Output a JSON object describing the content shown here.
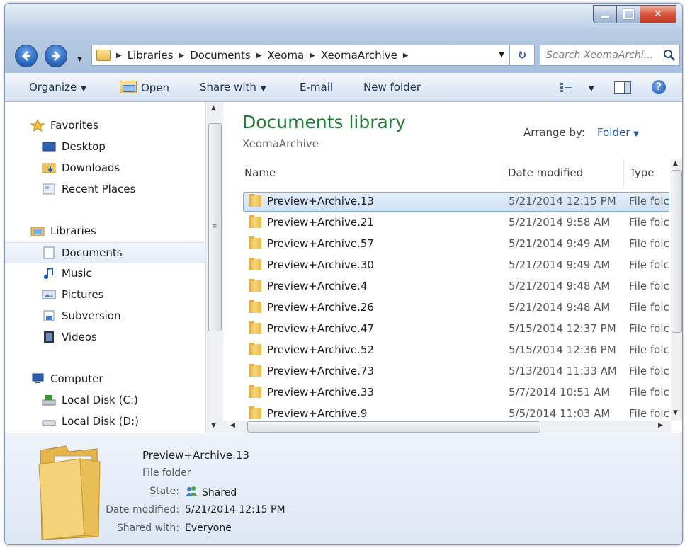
{
  "address_bar": {
    "crumbs": [
      "Libraries",
      "Documents",
      "Xeoma",
      "XeomaArchive"
    ]
  },
  "search": {
    "placeholder": "Search XeomaArchi..."
  },
  "toolbar": {
    "organize": "Organize",
    "open": "Open",
    "share_with": "Share with",
    "email": "E-mail",
    "new_folder": "New folder"
  },
  "nav": {
    "favorites_header": "Favorites",
    "favorites": [
      "Desktop",
      "Downloads",
      "Recent Places"
    ],
    "libraries_header": "Libraries",
    "libraries": [
      "Documents",
      "Music",
      "Pictures",
      "Subversion",
      "Videos"
    ],
    "computer_header": "Computer",
    "computer": [
      "Local Disk (C:)",
      "Local Disk (D:)"
    ]
  },
  "content": {
    "title": "Documents library",
    "subtitle": "XeomaArchive",
    "arrange_label": "Arrange by:",
    "arrange_value": "Folder",
    "columns": {
      "name": "Name",
      "date": "Date modified",
      "type": "Type"
    },
    "files": [
      {
        "name": "Preview+Archive.13",
        "date": "5/21/2014 12:15 PM",
        "type": "File folc"
      },
      {
        "name": "Preview+Archive.21",
        "date": "5/21/2014 9:58 AM",
        "type": "File folc"
      },
      {
        "name": "Preview+Archive.57",
        "date": "5/21/2014 9:49 AM",
        "type": "File folc"
      },
      {
        "name": "Preview+Archive.30",
        "date": "5/21/2014 9:49 AM",
        "type": "File folc"
      },
      {
        "name": "Preview+Archive.4",
        "date": "5/21/2014 9:48 AM",
        "type": "File folc"
      },
      {
        "name": "Preview+Archive.26",
        "date": "5/21/2014 9:48 AM",
        "type": "File folc"
      },
      {
        "name": "Preview+Archive.47",
        "date": "5/15/2014 12:37 PM",
        "type": "File folc"
      },
      {
        "name": "Preview+Archive.52",
        "date": "5/15/2014 12:36 PM",
        "type": "File folc"
      },
      {
        "name": "Preview+Archive.73",
        "date": "5/13/2014 11:33 AM",
        "type": "File folc"
      },
      {
        "name": "Preview+Archive.33",
        "date": "5/7/2014 10:51 AM",
        "type": "File folc"
      },
      {
        "name": "Preview+Archive.9",
        "date": "5/5/2014 11:03 AM",
        "type": "File folc"
      }
    ]
  },
  "details": {
    "name": "Preview+Archive.13",
    "type": "File folder",
    "state_label": "State:",
    "state_value": "Shared",
    "date_label": "Date modified:",
    "date_value": "5/21/2014 12:15 PM",
    "shared_label": "Shared with:",
    "shared_value": "Everyone"
  }
}
